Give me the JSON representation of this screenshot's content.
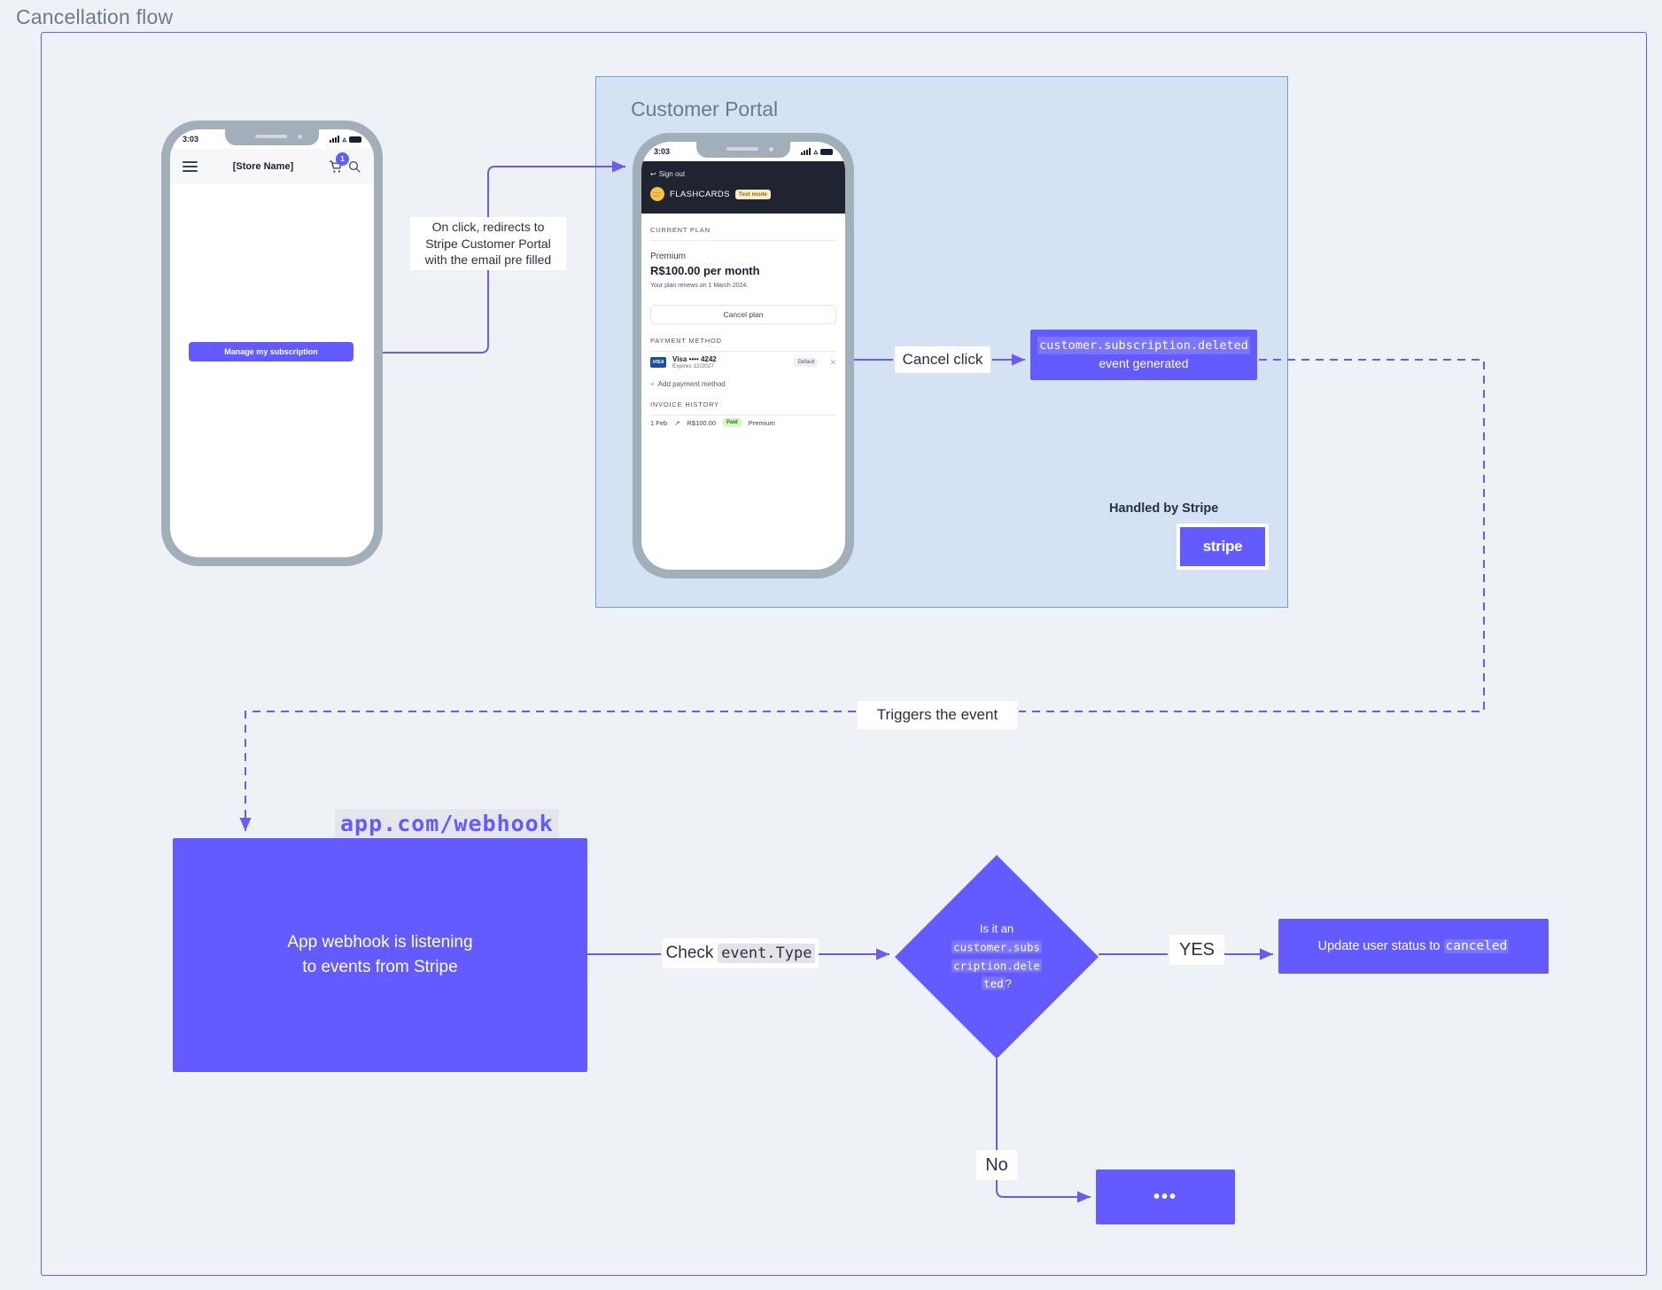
{
  "title": "Cancellation flow",
  "groups": {
    "customer_portal": {
      "title": "Customer Portal"
    }
  },
  "store_phone": {
    "status_time": "3:03",
    "menu_icon": "hamburger-icon",
    "store_name": "[Store Name]",
    "cart_badge": "1",
    "search_icon": "search-icon",
    "manage_button": "Manage my subscription"
  },
  "portal_phone": {
    "status_time": "3:03",
    "sign_out": "Sign out",
    "brand": "FLASHCARDS",
    "test_mode": "Test mode",
    "current_plan_label": "CURRENT PLAN",
    "plan_name": "Premium",
    "plan_price": "R$100.00 per month",
    "plan_renew": "Your plan renews on 1 March 2024.",
    "cancel_plan": "Cancel plan",
    "payment_method_label": "PAYMENT METHOD",
    "card_brand": "VISA",
    "card_main": "Visa •••• 4242",
    "card_expiry": "Expires 12/2027",
    "default_chip": "Default",
    "remove_icon": "close-icon",
    "add_payment_method": "Add payment method",
    "invoice_history_label": "INVOICE HISTORY",
    "invoice": {
      "date": "1 Feb",
      "link_icon": "external-link-icon",
      "amount": "R$100.00",
      "status": "Paid",
      "plan": "Premium"
    }
  },
  "annotations": {
    "redirect_note_line1": "On click, redirects to",
    "redirect_note_line2": "Stripe Customer Portal",
    "redirect_note_line3": "with the email pre filled",
    "cancel_click": "Cancel click",
    "triggers_the_event": "Triggers the event",
    "handled_by_stripe": "Handled by Stripe",
    "yes": "YES",
    "no": "No",
    "check_prefix": "Check",
    "check_code": "event.Type"
  },
  "nodes": {
    "event_generated": {
      "code": "customer.subscription.deleted",
      "text": "event generated"
    },
    "stripe_logo": "stripe",
    "webhook_url": "app.com/webhook",
    "webhook_box_line1": "App webhook is listening",
    "webhook_box_line2": "to events from Stripe",
    "decision": {
      "line1": "Is it an",
      "code1": "customer.subs",
      "code2": "cription.dele",
      "code3": "ted",
      "suffix": "?"
    },
    "update_status_prefix": "Update user status to",
    "update_status_code": "canceled",
    "ellipsis": "•••"
  },
  "colors": {
    "accent": "#635bff",
    "edge": "#6c5ce7",
    "canvas": "#eef2f7",
    "group_bg": "#d4e2f4",
    "group_border": "#6d9fe0",
    "phone_shell": "#a3aebb",
    "portal_header": "#1f2430"
  }
}
